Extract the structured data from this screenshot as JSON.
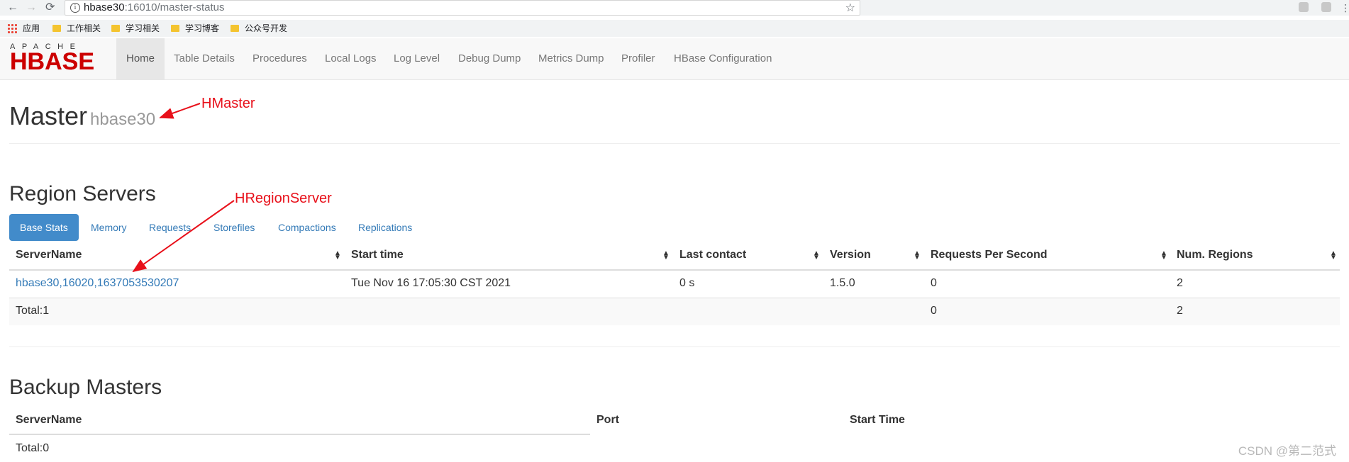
{
  "browser": {
    "url_host": "hbase30",
    "url_path": ":16010/master-status",
    "bookmarks": [
      "应用",
      "工作相关",
      "学习相关",
      "学习博客",
      "公众号开发"
    ]
  },
  "nav": {
    "logo_top": "APACHE",
    "logo_main": "HBASE",
    "items": [
      "Home",
      "Table Details",
      "Procedures",
      "Local Logs",
      "Log Level",
      "Debug Dump",
      "Metrics Dump",
      "Profiler",
      "HBase Configuration"
    ]
  },
  "master": {
    "title": "Master",
    "host": "hbase30"
  },
  "region_servers": {
    "title": "Region Servers",
    "tabs": [
      "Base Stats",
      "Memory",
      "Requests",
      "Storefiles",
      "Compactions",
      "Replications"
    ],
    "columns": [
      "ServerName",
      "Start time",
      "Last contact",
      "Version",
      "Requests Per Second",
      "Num. Regions"
    ],
    "rows": [
      [
        "hbase30,16020,1637053530207",
        "Tue Nov 16 17:05:30 CST 2021",
        "0 s",
        "1.5.0",
        "0",
        "2"
      ]
    ],
    "total": {
      "label": "Total:1",
      "requests": "0",
      "regions": "2"
    }
  },
  "backup_masters": {
    "title": "Backup Masters",
    "columns": [
      "ServerName",
      "Port",
      "Start Time"
    ],
    "total": "Total:0"
  },
  "annotations": {
    "hmaster": "HMaster",
    "hregionserver": "HRegionServer"
  },
  "watermark": "CSDN @第二范式",
  "colors": {
    "link": "#337ab7",
    "active_tab": "#428bca",
    "annotation": "#e8101a",
    "logo": "#cc0000"
  }
}
